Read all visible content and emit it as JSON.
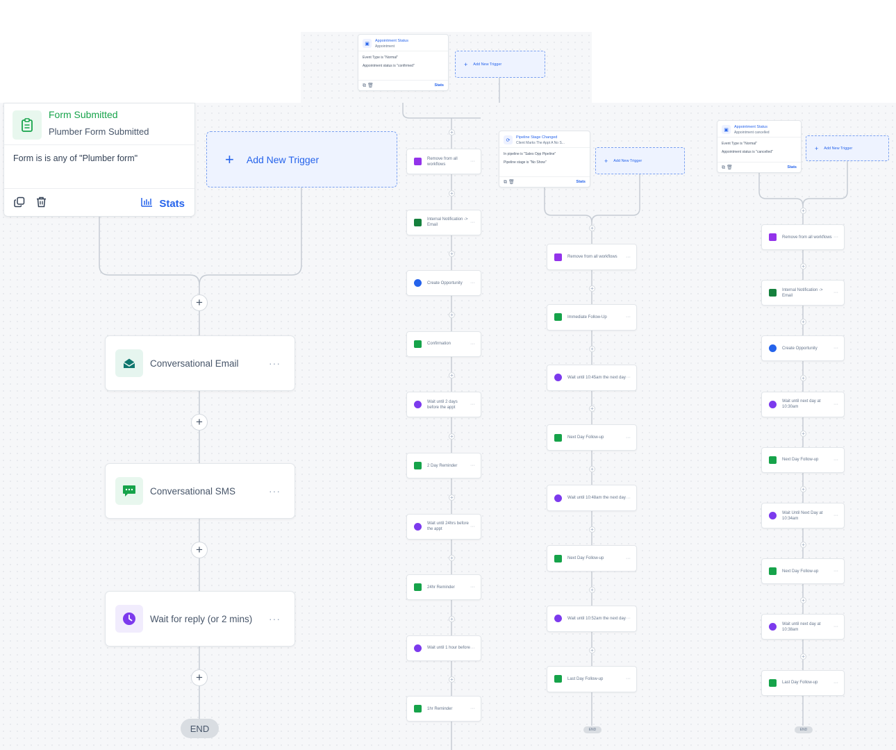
{
  "colors": {
    "accent": "#2563eb",
    "trigger_title": "#16a34a",
    "email_icon": "#0f766e",
    "sms_icon": "#16a34a",
    "wait_icon": "#7c3aed",
    "remove_icon": "#9333ea",
    "notify_icon": "#15803d",
    "opportunity_icon": "#2563eb"
  },
  "main": {
    "trigger": {
      "icon": "clipboard-icon",
      "title": "Form Submitted",
      "subtitle": "Plumber Form Submitted",
      "condition": "Form is is any of \"Plumber form\"",
      "stats_label": "Stats"
    },
    "add_trigger_label": "Add New Trigger",
    "actions": [
      {
        "icon": "envelope-open-icon",
        "label": "Conversational Email"
      },
      {
        "icon": "chat-icon",
        "label": "Conversational SMS"
      },
      {
        "icon": "clock-icon",
        "label": "Wait for reply (or 2 mins)"
      }
    ],
    "more_label": "···",
    "plus_label": "+",
    "end_label": "END"
  },
  "wf2": {
    "trigger": {
      "title": "Appointment Status",
      "subtitle": "Appointment",
      "line1": "Event Type is \"Normal\"",
      "line2": "Appointment status is \"confirmed\"",
      "stats_label": "Stats"
    },
    "add_trigger_label": "Add New Trigger",
    "actions": [
      {
        "icon": "remove-icon",
        "label": "Remove from all workflows"
      },
      {
        "icon": "notification-icon",
        "label": "Internal Notification -> Email"
      },
      {
        "icon": "opportunity-icon",
        "label": "Create Opportunity"
      },
      {
        "icon": "chat-icon",
        "label": "Confirmation"
      },
      {
        "icon": "clock-icon",
        "label": "Wait until 2 days before the appt"
      },
      {
        "icon": "chat-icon",
        "label": "2 Day Reminder"
      },
      {
        "icon": "clock-icon",
        "label": "Wait until 24hrs before the appt"
      },
      {
        "icon": "chat-icon",
        "label": "24hr Reminder"
      },
      {
        "icon": "clock-icon",
        "label": "Wait until 1 hour before"
      },
      {
        "icon": "chat-icon",
        "label": "1hr Reminder"
      }
    ]
  },
  "wf3": {
    "trigger": {
      "title": "Pipeline Stage Changed",
      "subtitle": "Client Marks The Appt A No S...",
      "line1": "In pipeline is \"Sales Opp Pipeline\"",
      "line2": "Pipeline stage is \"No Show\"",
      "stats_label": "Stats"
    },
    "add_trigger_label": "Add New Trigger",
    "actions": [
      {
        "icon": "remove-icon",
        "label": "Remove from all workflows"
      },
      {
        "icon": "chat-icon",
        "label": "Immediate Follow-Up"
      },
      {
        "icon": "clock-icon",
        "label": "Wait until 10:45am the next day"
      },
      {
        "icon": "chat-icon",
        "label": "Next Day Follow-up"
      },
      {
        "icon": "clock-icon",
        "label": "Wait until 10:48am the next day"
      },
      {
        "icon": "chat-icon",
        "label": "Next Day Follow-up"
      },
      {
        "icon": "clock-icon",
        "label": "Wait until 10:52am the next day"
      },
      {
        "icon": "chat-icon",
        "label": "Last Day Follow-up"
      }
    ],
    "end_label": "END"
  },
  "wf4": {
    "trigger": {
      "title": "Appointment Status",
      "subtitle": "Appointment cancelled",
      "line1": "Event Type is \"Normal\"",
      "line2": "Appointment status is \"cancelled\"",
      "stats_label": "Stats"
    },
    "add_trigger_label": "Add New Trigger",
    "actions": [
      {
        "icon": "remove-icon",
        "label": "Remove from all workflows"
      },
      {
        "icon": "notification-icon",
        "label": "Internal Notification -> Email"
      },
      {
        "icon": "opportunity-icon",
        "label": "Create Opportunity"
      },
      {
        "icon": "clock-icon",
        "label": "Wait until next day at 10:30am"
      },
      {
        "icon": "chat-icon",
        "label": "Next Day Follow-up"
      },
      {
        "icon": "clock-icon",
        "label": "Wait Until Next Day at 10:34am"
      },
      {
        "icon": "chat-icon",
        "label": "Next Day Follow-up"
      },
      {
        "icon": "clock-icon",
        "label": "Wait until next day at 10:38am"
      },
      {
        "icon": "chat-icon",
        "label": "Last Day Follow-up"
      }
    ],
    "end_label": "END"
  }
}
